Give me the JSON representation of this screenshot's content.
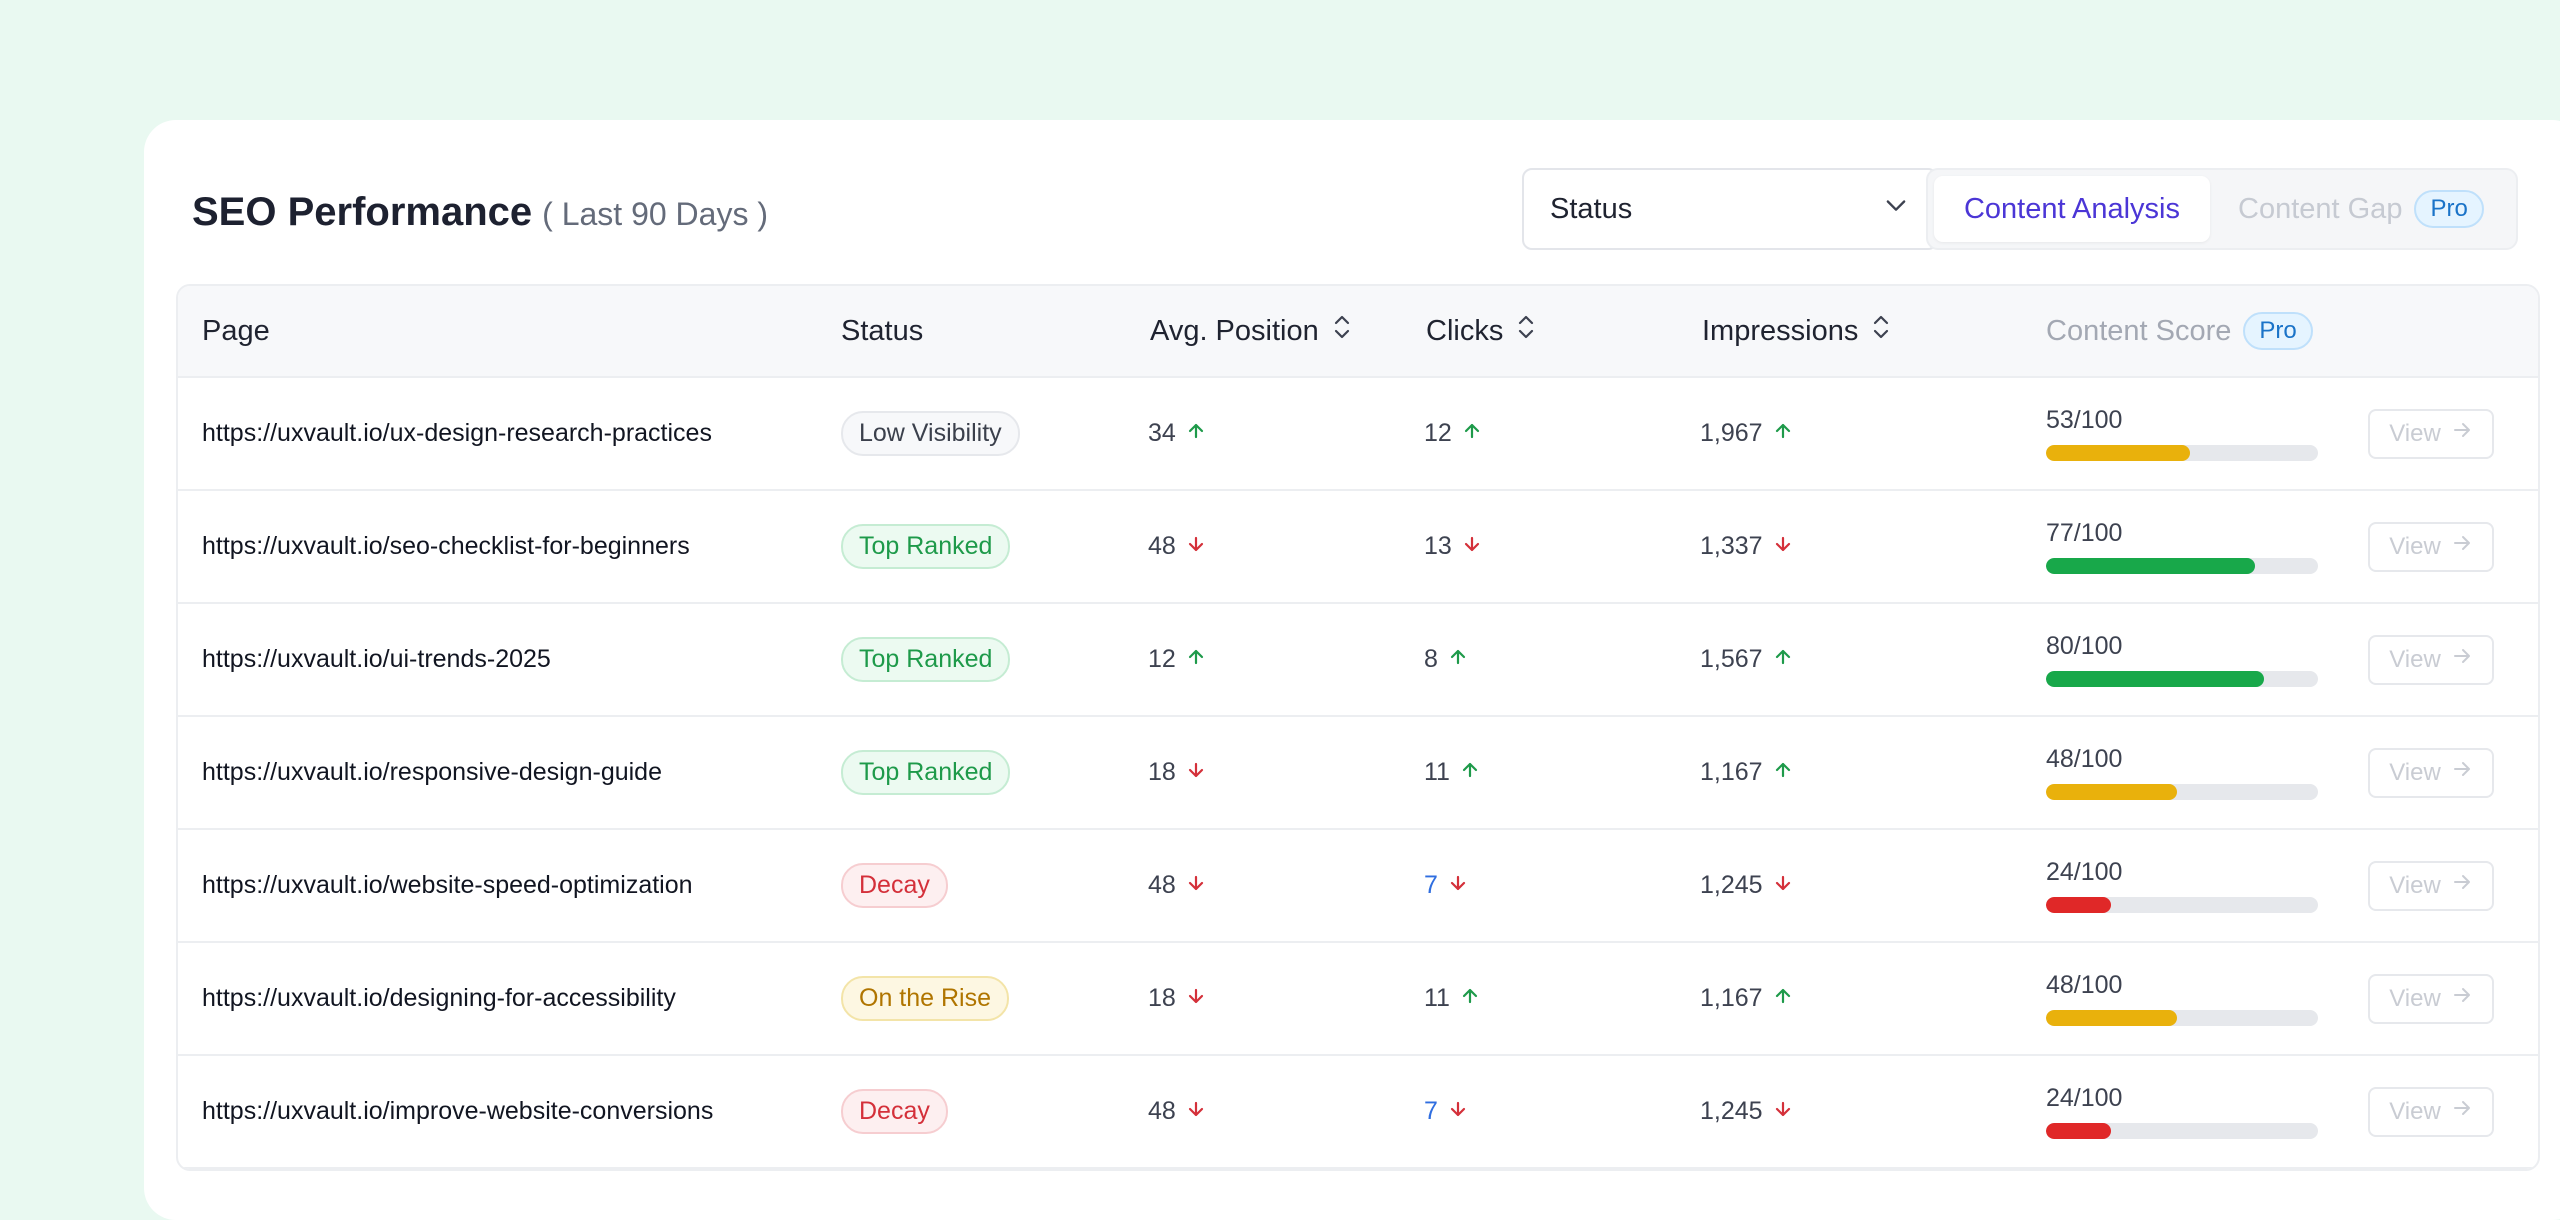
{
  "header": {
    "title": "SEO Performance",
    "subtitle": "( Last 90 Days )",
    "status_select": {
      "value": "Status"
    },
    "tabs": [
      {
        "label": "Content Analysis",
        "active": true
      },
      {
        "label": "Content Gap",
        "badge": "Pro",
        "disabled": true
      }
    ]
  },
  "table": {
    "columns": {
      "page": "Page",
      "status": "Status",
      "avg_position": "Avg. Position",
      "clicks": "Clicks",
      "impressions": "Impressions",
      "content_score": "Content Score",
      "content_score_badge": "Pro"
    },
    "view_label": "View",
    "rows": [
      {
        "url": "https://uxvault.io/ux-design-research-practices",
        "status": "Low Visibility",
        "status_color": "gray",
        "position": "34",
        "position_trend": "up",
        "clicks": "12",
        "clicks_trend": "up",
        "clicks_highlight": false,
        "impressions": "1,967",
        "impressions_trend": "up",
        "score_text": "53/100",
        "score": 53,
        "score_color": "#e9b10c"
      },
      {
        "url": "https://uxvault.io/seo-checklist-for-beginners",
        "status": "Top Ranked",
        "status_color": "green",
        "position": "48",
        "position_trend": "down",
        "clicks": "13",
        "clicks_trend": "down",
        "clicks_highlight": false,
        "impressions": "1,337",
        "impressions_trend": "down",
        "score_text": "77/100",
        "score": 77,
        "score_color": "#18a84a"
      },
      {
        "url": "https://uxvault.io/ui-trends-2025",
        "status": "Top Ranked",
        "status_color": "green",
        "position": "12",
        "position_trend": "up",
        "clicks": "8",
        "clicks_trend": "up",
        "clicks_highlight": false,
        "impressions": "1,567",
        "impressions_trend": "up",
        "score_text": "80/100",
        "score": 80,
        "score_color": "#18a84a"
      },
      {
        "url": "https://uxvault.io/responsive-design-guide",
        "status": "Top Ranked",
        "status_color": "green",
        "position": "18",
        "position_trend": "down",
        "clicks": "11",
        "clicks_trend": "up",
        "clicks_highlight": false,
        "impressions": "1,167",
        "impressions_trend": "up",
        "score_text": "48/100",
        "score": 48,
        "score_color": "#e9b10c"
      },
      {
        "url": "https://uxvault.io/website-speed-optimization",
        "status": "Decay",
        "status_color": "red",
        "position": "48",
        "position_trend": "down",
        "clicks": "7",
        "clicks_trend": "down",
        "clicks_highlight": true,
        "impressions": "1,245",
        "impressions_trend": "down",
        "score_text": "24/100",
        "score": 24,
        "score_color": "#e02828"
      },
      {
        "url": "https://uxvault.io/designing-for-accessibility",
        "status": "On the Rise",
        "status_color": "yellow",
        "position": "18",
        "position_trend": "down",
        "clicks": "11",
        "clicks_trend": "up",
        "clicks_highlight": false,
        "impressions": "1,167",
        "impressions_trend": "up",
        "score_text": "48/100",
        "score": 48,
        "score_color": "#e9b10c"
      },
      {
        "url": "https://uxvault.io/improve-website-conversions",
        "status": "Decay",
        "status_color": "red",
        "position": "48",
        "position_trend": "down",
        "clicks": "7",
        "clicks_trend": "down",
        "clicks_highlight": true,
        "impressions": "1,245",
        "impressions_trend": "down",
        "score_text": "24/100",
        "score": 24,
        "score_color": "#e02828"
      }
    ]
  },
  "colors": {
    "trend_up": "#1e9a4a",
    "trend_down": "#d4303a",
    "accent": "#4b36d6"
  }
}
